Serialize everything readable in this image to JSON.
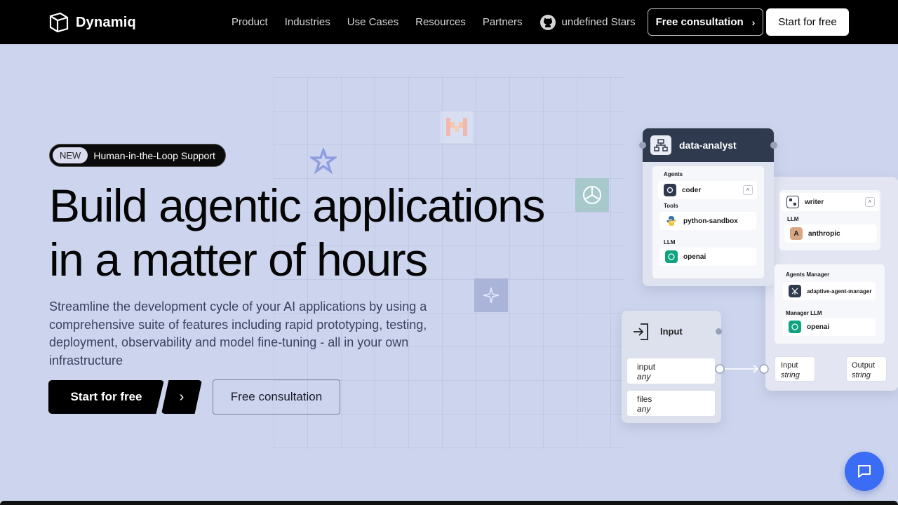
{
  "header": {
    "brand": "Dynamiq",
    "nav": [
      "Product",
      "Industries",
      "Use Cases",
      "Resources",
      "Partners"
    ],
    "github_stars": "undefined Stars",
    "consult_label": "Free consultation",
    "start_label": "Start for free"
  },
  "hero": {
    "badge_new": "NEW",
    "badge_text": "Human-in-the-Loop Support",
    "title_line1": "Build agentic applications",
    "title_line2": "in a matter of hours",
    "subtitle": "Streamline the development cycle of your AI applications by using a comprehensive suite of features including rapid prototyping, testing, deployment, observability and model fine-tuning - all in your own infrastructure",
    "cta_primary": "Start for free",
    "cta_secondary": "Free consultation"
  },
  "diagram": {
    "node_title": "data-analyst",
    "agents_label": "Agents",
    "agent_coder": "coder",
    "tools_label": "Tools",
    "tool_python": "python-sandbox",
    "llm_label": "LLM",
    "llm_openai": "openai",
    "writer": "writer",
    "writer_llm_label": "LLM",
    "writer_llm": "anthropic",
    "agents_manager_label": "Agents Manager",
    "agents_manager": "adaptive-agent-manager",
    "manager_llm_label": "Manager LLM",
    "manager_llm": "openai",
    "input_node": "Input",
    "input_field": "input",
    "input_type": "any",
    "files_field": "files",
    "files_type": "any",
    "out_input_label": "Input",
    "out_input_type": "string",
    "out_output_label": "Output",
    "out_output_type": "string"
  },
  "colors": {
    "background": "#cdd5ee",
    "header": "#000000",
    "chat_button": "#3b6cf6",
    "node_header": "#2f3a4e"
  }
}
